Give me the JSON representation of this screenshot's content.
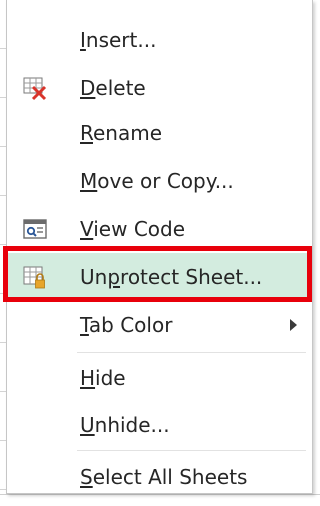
{
  "menu": {
    "items": [
      {
        "label_pre": "",
        "label_u": "I",
        "label_post": "nsert...",
        "icon": "",
        "submenu": false
      },
      {
        "label_pre": "",
        "label_u": "D",
        "label_post": "elete",
        "icon": "delete-sheet-icon",
        "submenu": false
      },
      {
        "label_pre": "",
        "label_u": "R",
        "label_post": "ename",
        "icon": "",
        "submenu": false
      },
      {
        "label_pre": "",
        "label_u": "M",
        "label_post": "ove or Copy...",
        "icon": "",
        "submenu": false
      },
      {
        "label_pre": "",
        "label_u": "V",
        "label_post": "iew Code",
        "icon": "view-code-icon",
        "submenu": false
      },
      {
        "label_pre": "Un",
        "label_u": "p",
        "label_post": "rotect Sheet...",
        "icon": "protect-sheet-icon",
        "submenu": false
      },
      {
        "label_pre": "",
        "label_u": "T",
        "label_post": "ab Color",
        "icon": "",
        "submenu": true
      },
      {
        "label_pre": "",
        "label_u": "H",
        "label_post": "ide",
        "icon": "",
        "submenu": false
      },
      {
        "label_pre": "",
        "label_u": "U",
        "label_post": "nhide...",
        "icon": "",
        "submenu": false
      },
      {
        "label_pre": "",
        "label_u": "S",
        "label_post": "elect All Sheets",
        "icon": "",
        "submenu": false
      }
    ],
    "highlighted_index": 5
  },
  "colors": {
    "highlight_fill": "#d3ecdf",
    "annotation_border": "#e8000b",
    "delete_icon_red": "#d9342b",
    "lock_gold": "#e7a52b"
  }
}
